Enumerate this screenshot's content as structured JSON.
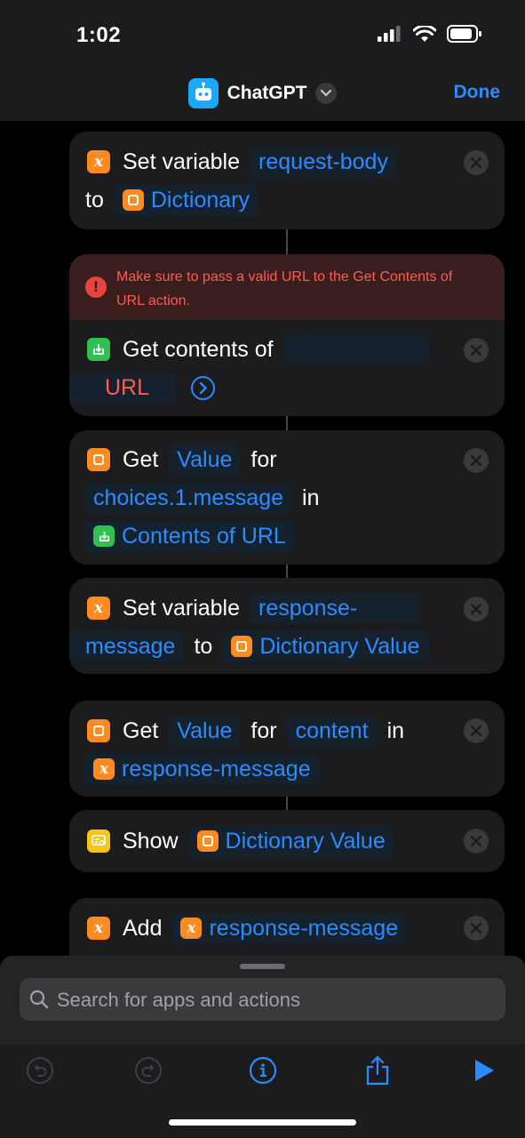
{
  "status": {
    "time": "1:02"
  },
  "nav": {
    "title": "ChatGPT",
    "done_label": "Done"
  },
  "actions": {
    "set_request": {
      "word_set": "Set variable",
      "var_name": "request-body",
      "word_to": "to",
      "value": "Dictionary"
    },
    "get_contents": {
      "warning": "Make sure to pass a valid URL to the Get Contents of URL action.",
      "word": "Get contents of",
      "url_token": "URL"
    },
    "get_value_1": {
      "word_get": "Get",
      "token_value": "Value",
      "word_for": "for",
      "key": "choices.1.message",
      "word_in": "in",
      "source": "Contents of URL"
    },
    "set_response": {
      "word_set": "Set variable",
      "var_part1": "response-",
      "var_part2": "message",
      "word_to": "to",
      "value": "Dictionary Value"
    },
    "get_value_2": {
      "word_get": "Get",
      "token_value": "Value",
      "word_for": "for",
      "key": "content",
      "word_in": "in",
      "source": "response-message"
    },
    "show": {
      "word": "Show",
      "value": "Dictionary Value"
    },
    "add": {
      "word": "Add",
      "value": "response-message"
    }
  },
  "search": {
    "placeholder": "Search for apps and actions"
  },
  "colors": {
    "accent": "#2a8cff",
    "error": "#ff5b4f",
    "variable_orange": "#ff8a1f",
    "download_green": "#30c04f",
    "show_yellow": "#f5c518",
    "app_icon_blue": "#1ea7ff"
  },
  "icons": {
    "toolbar": [
      "undo-icon",
      "redo-icon",
      "info-icon",
      "share-icon",
      "play-icon"
    ]
  }
}
